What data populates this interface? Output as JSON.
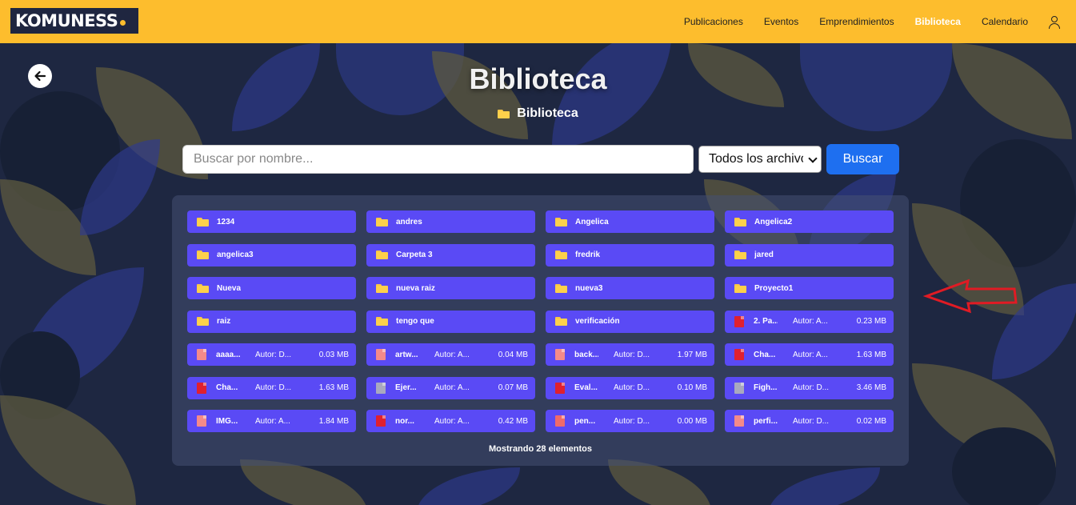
{
  "header": {
    "logo_text": "KOMUNESS",
    "nav": [
      {
        "label": "Publicaciones",
        "active": false
      },
      {
        "label": "Eventos",
        "active": false
      },
      {
        "label": "Emprendimientos",
        "active": false
      },
      {
        "label": "Biblioteca",
        "active": true
      },
      {
        "label": "Calendario",
        "active": false
      }
    ],
    "user_icon": "user-icon"
  },
  "page": {
    "title": "Biblioteca",
    "breadcrumb": "Biblioteca"
  },
  "search": {
    "placeholder": "Buscar por nombre...",
    "filter_value": "Todos los archivos",
    "button_label": "Buscar"
  },
  "folders": [
    "1234",
    "andres",
    "Angelica",
    "Angelica2",
    "angelica3",
    "Carpeta 3",
    "fredrik",
    "jared",
    "Nueva",
    "nueva raiz",
    "nueva3",
    "Proyecto1",
    "raiz",
    "tengo que",
    "verificación"
  ],
  "files": [
    {
      "name": "2. Pa...",
      "author": "Autor: A...",
      "size": "0.23 MB",
      "icon_color": "#e0202f"
    },
    {
      "name": "aaaa...",
      "author": "Autor: D...",
      "size": "0.03 MB",
      "icon_color": "#f48a8a"
    },
    {
      "name": "artw...",
      "author": "Autor: A...",
      "size": "0.04 MB",
      "icon_color": "#f48a8a"
    },
    {
      "name": "back...",
      "author": "Autor: D...",
      "size": "1.97 MB",
      "icon_color": "#f48a8a"
    },
    {
      "name": "Cha...",
      "author": "Autor: A...",
      "size": "1.63 MB",
      "icon_color": "#e0202f"
    },
    {
      "name": "Cha...",
      "author": "Autor: D...",
      "size": "1.63 MB",
      "icon_color": "#e0202f"
    },
    {
      "name": "Ejer...",
      "author": "Autor: A...",
      "size": "0.07 MB",
      "icon_color": "#a9a9bf"
    },
    {
      "name": "Eval...",
      "author": "Autor: D...",
      "size": "0.10 MB",
      "icon_color": "#e0202f"
    },
    {
      "name": "Figh...",
      "author": "Autor: D...",
      "size": "3.46 MB",
      "icon_color": "#a9a9bf"
    },
    {
      "name": "IMG...",
      "author": "Autor: A...",
      "size": "1.84 MB",
      "icon_color": "#f48a8a"
    },
    {
      "name": "nor...",
      "author": "Autor: A...",
      "size": "0.42 MB",
      "icon_color": "#e0202f"
    },
    {
      "name": "pen...",
      "author": "Autor: D...",
      "size": "0.00 MB",
      "icon_color": "#f06a6a"
    },
    {
      "name": "perfi...",
      "author": "Autor: D...",
      "size": "0.02 MB",
      "icon_color": "#f48a8a"
    }
  ],
  "footer": "Mostrando 28 elementos",
  "colors": {
    "header_bg": "#fdbd2d",
    "item_bg": "#5a4af5",
    "button_bg": "#1e6ff0",
    "annotation_arrow": "#e01b24"
  }
}
